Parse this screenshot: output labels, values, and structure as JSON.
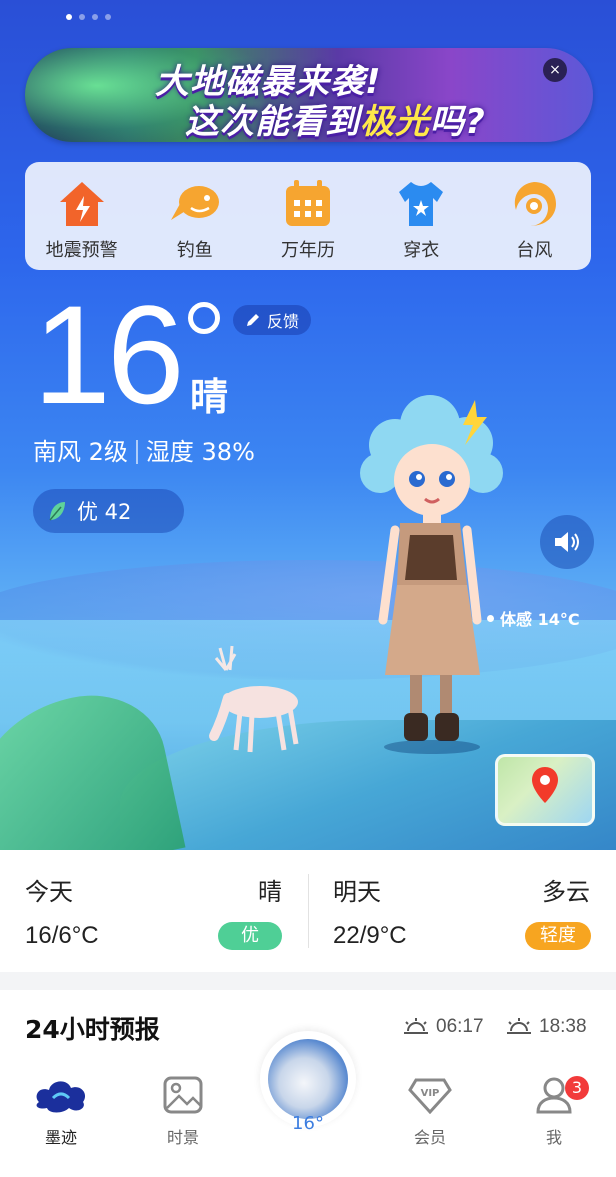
{
  "banner": {
    "line1": "大地磁暴来袭!",
    "line2_pre": "这次能看到",
    "line2_hl": "极光",
    "line2_post": "吗?",
    "close": "×"
  },
  "tools": [
    {
      "label": "地震预警",
      "icon": "house-quake-icon",
      "color": "#f2642a"
    },
    {
      "label": "钓鱼",
      "icon": "fish-icon",
      "color": "#f6a530"
    },
    {
      "label": "万年历",
      "icon": "calendar-icon",
      "color": "#f6a530"
    },
    {
      "label": "穿衣",
      "icon": "tshirt-icon",
      "color": "#2b8bf0"
    },
    {
      "label": "台风",
      "icon": "typhoon-icon",
      "color": "#f6a530"
    }
  ],
  "current": {
    "temp": "16",
    "condition": "晴",
    "feedback": "反馈",
    "wind": "南风 2级",
    "humidity": "湿度 38%",
    "aqi": "优 42",
    "feels_like": "体感 14°C"
  },
  "forecast": {
    "today": {
      "day": "今天",
      "weather": "晴",
      "temp": "16/6°C",
      "aqi": "优",
      "aqi_color": "#4fcf96"
    },
    "tomorrow": {
      "day": "明天",
      "weather": "多云",
      "temp": "22/9°C",
      "aqi": "轻度",
      "aqi_color": "#f7a520"
    }
  },
  "hourly": {
    "title": "24小时预报",
    "sunrise": "06:17",
    "sunset": "18:38"
  },
  "tabbar": {
    "tabs": [
      {
        "label": "墨迹"
      },
      {
        "label": "时景"
      },
      {
        "label": "会员"
      },
      {
        "label": "我"
      }
    ],
    "center_temp": "16°",
    "badge": "3"
  }
}
